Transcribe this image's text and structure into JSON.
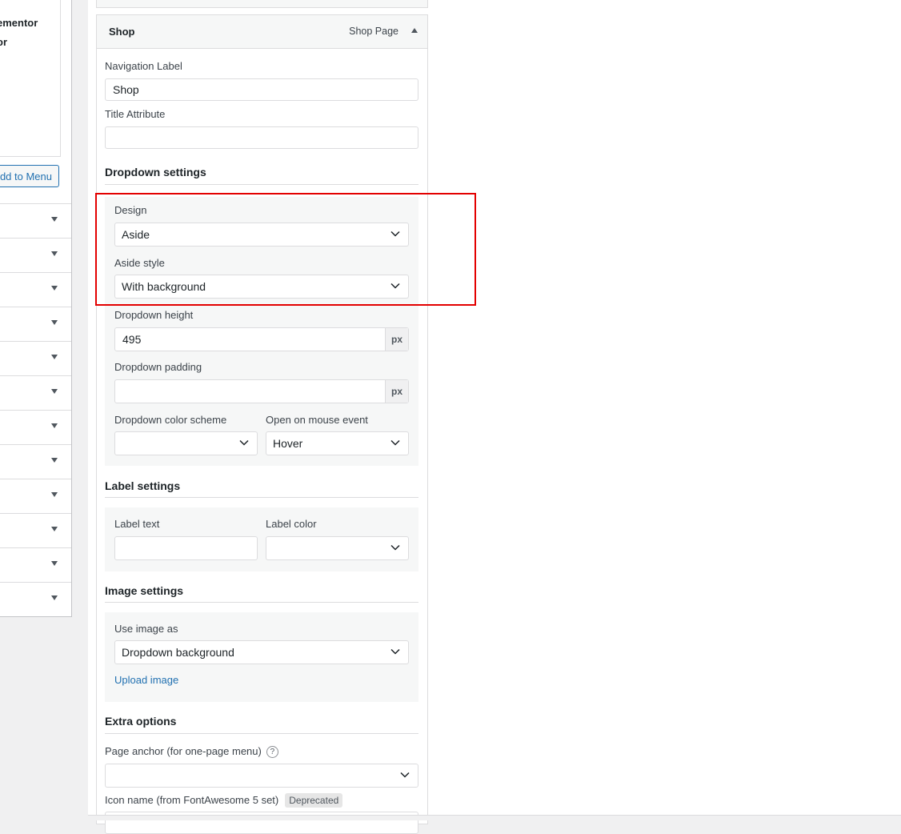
{
  "left": {
    "box_lines": [
      "ementor",
      "or"
    ],
    "add_to_menu": "dd to Menu",
    "rows": 12
  },
  "item": {
    "title": "Shop",
    "type": "Shop Page",
    "nav_label_label": "Navigation Label",
    "nav_label_value": "Shop",
    "title_attr_label": "Title Attribute",
    "title_attr_value": ""
  },
  "dropdown": {
    "section_title": "Dropdown settings",
    "design_label": "Design",
    "design_value": "Aside",
    "aside_style_label": "Aside style",
    "aside_style_value": "With background",
    "height_label": "Dropdown height",
    "height_value": "495",
    "height_unit": "px",
    "padding_label": "Dropdown padding",
    "padding_value": "",
    "padding_unit": "px",
    "color_scheme_label": "Dropdown color scheme",
    "color_scheme_value": "",
    "mouse_event_label": "Open on mouse event",
    "mouse_event_value": "Hover"
  },
  "label_settings": {
    "section_title": "Label settings",
    "text_label": "Label text",
    "text_value": "",
    "color_label": "Label color",
    "color_value": ""
  },
  "image_settings": {
    "section_title": "Image settings",
    "use_as_label": "Use image as",
    "use_as_value": "Dropdown background",
    "upload_link": "Upload image"
  },
  "extra": {
    "section_title": "Extra options",
    "anchor_label": "Page anchor (for one-page menu)",
    "anchor_help": "?",
    "anchor_value": "",
    "icon_label": "Icon name (from FontAwesome 5 set)",
    "icon_badge": "Deprecated"
  },
  "colors": {
    "highlight": "#e30000",
    "link": "#2271b1"
  }
}
